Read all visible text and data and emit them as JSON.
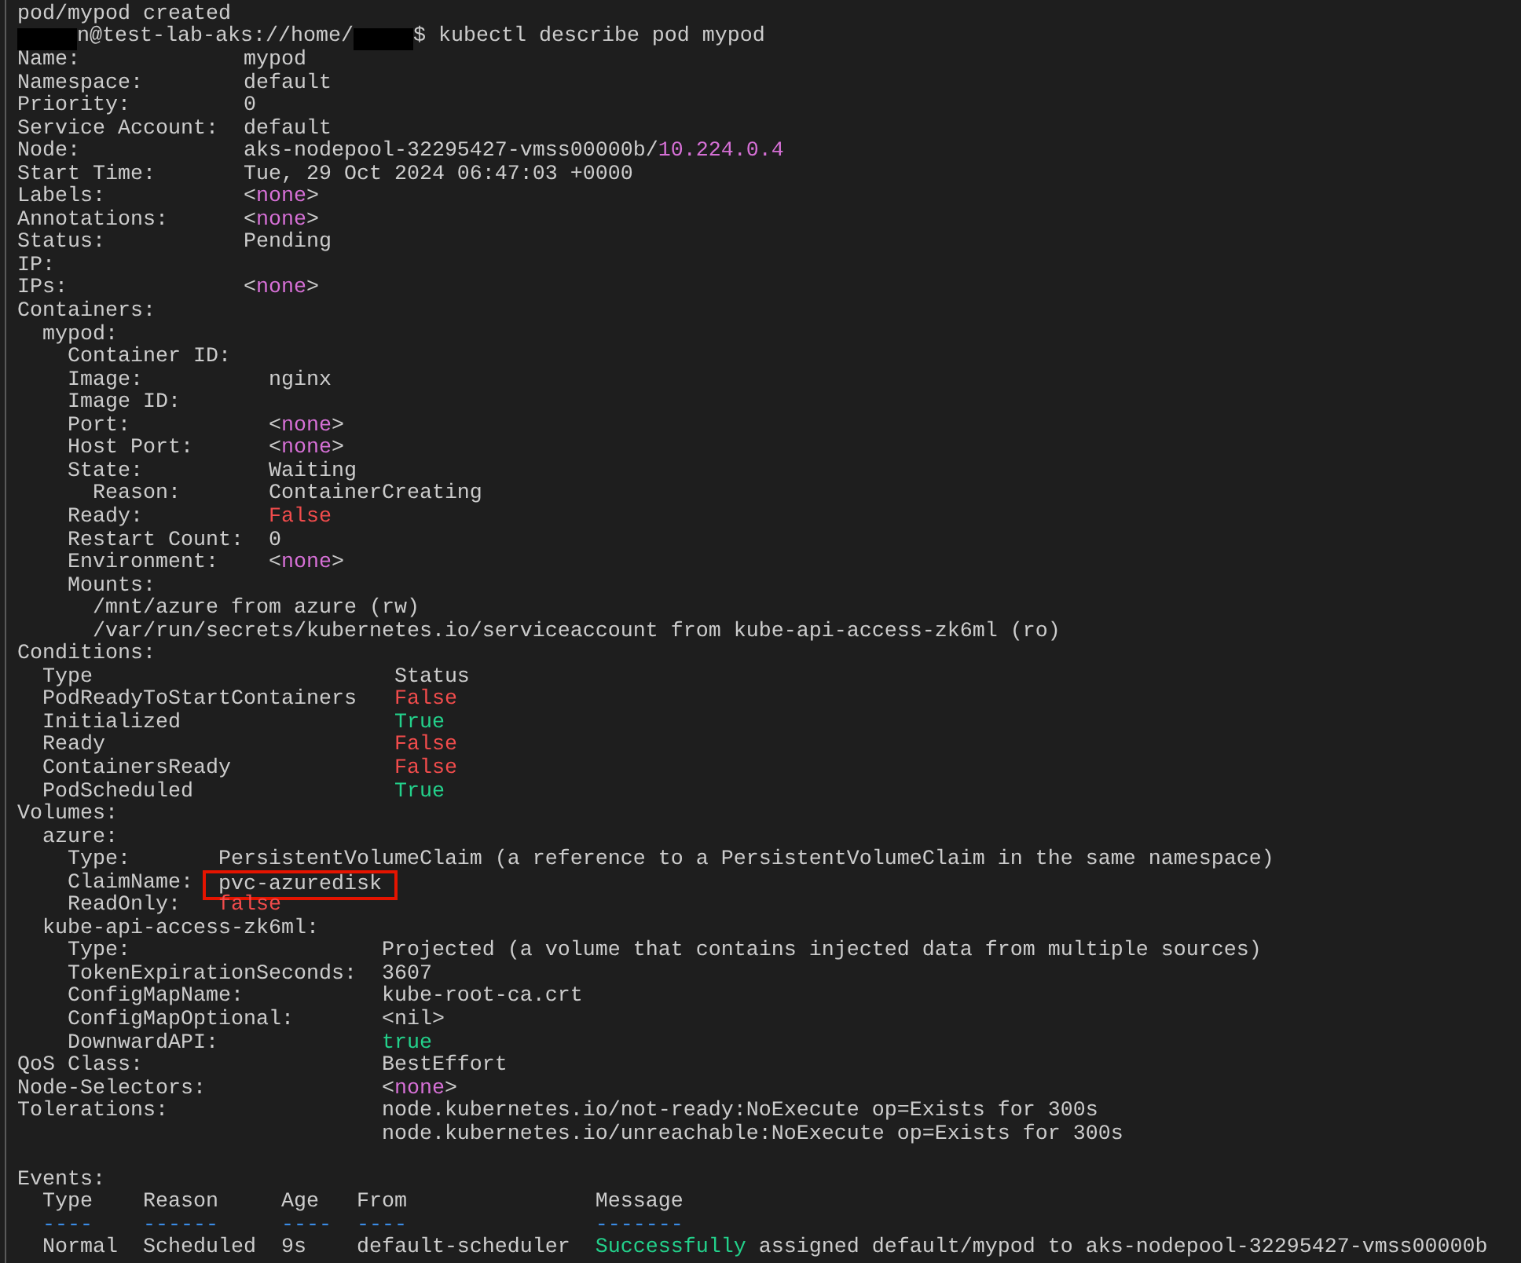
{
  "terminal": {
    "lines": [
      {
        "kind": "output",
        "segments": [
          "pod/mypod created"
        ]
      },
      {
        "kind": "output",
        "segments": [
          {
            "kind": "redacted"
          },
          "n@test-lab-aks://home/",
          {
            "kind": "redacted"
          },
          "$ kubectl describe pod mypod"
        ]
      },
      {
        "kind": "output",
        "segments": [
          "Name:             mypod"
        ]
      },
      {
        "kind": "output",
        "segments": [
          "Namespace:        default"
        ]
      },
      {
        "kind": "output",
        "segments": [
          "Priority:         0"
        ]
      },
      {
        "kind": "output",
        "segments": [
          "Service Account:  default"
        ]
      },
      {
        "kind": "output",
        "segments": [
          "Node:             aks-nodepool-32295427-vmss00000b/",
          {
            "kind": "address",
            "text": "10.224.0.4"
          }
        ]
      },
      {
        "kind": "output",
        "segments": [
          "Start Time:       Tue, 29 Oct 2024 06:47:03 +0000"
        ]
      },
      {
        "kind": "output",
        "segments": [
          "Labels:           <",
          {
            "kind": "none",
            "text": "none"
          },
          ">"
        ]
      },
      {
        "kind": "output",
        "segments": [
          "Annotations:      <",
          {
            "kind": "none",
            "text": "none"
          },
          ">"
        ]
      },
      {
        "kind": "output",
        "segments": [
          "Status:           Pending"
        ]
      },
      {
        "kind": "output",
        "segments": [
          "IP:"
        ]
      },
      {
        "kind": "output",
        "segments": [
          "IPs:              <",
          {
            "kind": "none",
            "text": "none"
          },
          ">"
        ]
      },
      {
        "kind": "output",
        "segments": [
          "Containers:"
        ]
      },
      {
        "kind": "output",
        "segments": [
          "  mypod:"
        ]
      },
      {
        "kind": "output",
        "segments": [
          "    Container ID:"
        ]
      },
      {
        "kind": "output",
        "segments": [
          "    Image:          nginx"
        ]
      },
      {
        "kind": "output",
        "segments": [
          "    Image ID:"
        ]
      },
      {
        "kind": "output",
        "segments": [
          "    Port:           <",
          {
            "kind": "none",
            "text": "none"
          },
          ">"
        ]
      },
      {
        "kind": "output",
        "segments": [
          "    Host Port:      <",
          {
            "kind": "none",
            "text": "none"
          },
          ">"
        ]
      },
      {
        "kind": "output",
        "segments": [
          "    State:          Waiting"
        ]
      },
      {
        "kind": "output",
        "segments": [
          "      Reason:       ContainerCreating"
        ]
      },
      {
        "kind": "output",
        "segments": [
          "    Ready:          ",
          {
            "kind": "bad",
            "text": "False"
          }
        ]
      },
      {
        "kind": "output",
        "segments": [
          "    Restart Count:  0"
        ]
      },
      {
        "kind": "output",
        "segments": [
          "    Environment:    <",
          {
            "kind": "none",
            "text": "none"
          },
          ">"
        ]
      },
      {
        "kind": "output",
        "segments": [
          "    Mounts:"
        ]
      },
      {
        "kind": "output",
        "segments": [
          "      /mnt/azure from azure (rw)"
        ]
      },
      {
        "kind": "output",
        "segments": [
          "      /var/run/secrets/kubernetes.io/serviceaccount from kube-api-access-zk6ml (ro)"
        ]
      },
      {
        "kind": "output",
        "segments": [
          "Conditions:"
        ]
      },
      {
        "kind": "output",
        "segments": [
          "  Type                        Status"
        ]
      },
      {
        "kind": "output",
        "segments": [
          "  PodReadyToStartContainers   ",
          {
            "kind": "bad",
            "text": "False"
          }
        ]
      },
      {
        "kind": "output",
        "segments": [
          "  Initialized                 ",
          {
            "kind": "good",
            "text": "True"
          }
        ]
      },
      {
        "kind": "output",
        "segments": [
          "  Ready                       ",
          {
            "kind": "bad",
            "text": "False"
          }
        ]
      },
      {
        "kind": "output",
        "segments": [
          "  ContainersReady             ",
          {
            "kind": "bad",
            "text": "False"
          }
        ]
      },
      {
        "kind": "output",
        "segments": [
          "  PodScheduled                ",
          {
            "kind": "good",
            "text": "True"
          }
        ]
      },
      {
        "kind": "output",
        "segments": [
          "Volumes:"
        ]
      },
      {
        "kind": "output",
        "segments": [
          "  azure:"
        ]
      },
      {
        "kind": "output",
        "segments": [
          "    Type:       PersistentVolumeClaim (a reference to a PersistentVolumeClaim in the same namespace)"
        ]
      },
      {
        "kind": "output",
        "segments": [
          "    ClaimName:  ",
          {
            "kind": "boxed",
            "text": "pvc-azuredisk"
          }
        ]
      },
      {
        "kind": "output",
        "segments": [
          "    ReadOnly:   ",
          {
            "kind": "bad",
            "text": "false"
          }
        ]
      },
      {
        "kind": "output",
        "segments": [
          "  kube-api-access-zk6ml:"
        ]
      },
      {
        "kind": "output",
        "segments": [
          "    Type:                    Projected (a volume that contains injected data from multiple sources)"
        ]
      },
      {
        "kind": "output",
        "segments": [
          "    TokenExpirationSeconds:  3607"
        ]
      },
      {
        "kind": "output",
        "segments": [
          "    ConfigMapName:           kube-root-ca.crt"
        ]
      },
      {
        "kind": "output",
        "segments": [
          "    ConfigMapOptional:       <nil>"
        ]
      },
      {
        "kind": "output",
        "segments": [
          "    DownwardAPI:             ",
          {
            "kind": "good",
            "text": "true"
          }
        ]
      },
      {
        "kind": "output",
        "segments": [
          "QoS Class:                   BestEffort"
        ]
      },
      {
        "kind": "output",
        "segments": [
          "Node-Selectors:              <",
          {
            "kind": "none",
            "text": "none"
          },
          ">"
        ]
      },
      {
        "kind": "output",
        "segments": [
          "Tolerations:                 node.kubernetes.io/not-ready:NoExecute op=Exists for 300s"
        ]
      },
      {
        "kind": "output",
        "segments": [
          "                             node.kubernetes.io/unreachable:NoExecute op=Exists for 300s"
        ]
      },
      {
        "kind": "blank"
      },
      {
        "kind": "output",
        "segments": [
          "Events:"
        ]
      },
      {
        "kind": "output",
        "segments": [
          "  Type    Reason     Age   From               Message"
        ]
      },
      {
        "kind": "output",
        "segments": [
          {
            "kind": "rule",
            "text": "  ----    ------     ----  ----               -------"
          }
        ]
      },
      {
        "kind": "output",
        "segments": [
          "  Normal  Scheduled  9s    default-scheduler  ",
          {
            "kind": "good",
            "text": "Successfully"
          },
          " assigned default/mypod to aks-nodepool-32295427-vmss00000b"
        ]
      }
    ]
  }
}
